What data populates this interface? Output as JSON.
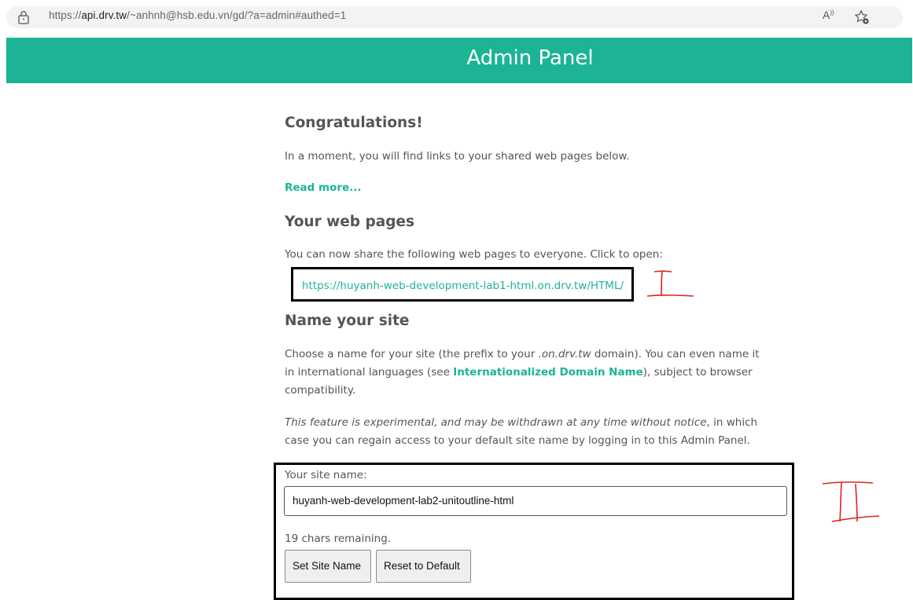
{
  "browser": {
    "url_prefix": "https://",
    "url_host": "api.drv.tw",
    "url_rest": "/~anhnh@hsb.edu.vn/gd/?a=admin#authed=1",
    "read_aloud_label": "A",
    "icons": [
      "site-info-icon",
      "read-aloud-icon",
      "favorites-icon"
    ]
  },
  "header": {
    "title": "Admin Panel",
    "color": "#1cb495"
  },
  "congrats": {
    "heading": "Congratulations!",
    "text": "In a moment, you will find links to your shared web pages below.",
    "read_more": "Read more..."
  },
  "web_pages": {
    "heading": "Your web pages",
    "text": "You can now share the following web pages to everyone. Click to open:",
    "link": "https://huyanh-web-development-lab1-html.on.drv.tw/HTML/"
  },
  "name_site": {
    "heading": "Name your site",
    "p1_a": "Choose a name for your site (the prefix to your ",
    "p1_domain": ".on.drv.tw",
    "p1_b": " domain). You can even name it in international languages (see ",
    "p1_link": "Internationalized Domain Name",
    "p1_c": "), subject to browser compatibility.",
    "p2_italic": "This feature is experimental, and may be withdrawn at any time without notice",
    "p2_rest": ", in which case you can regain access to your default site name by logging in to this Admin Panel.",
    "label": "Your site name:",
    "input_value": "huyanh-web-development-lab2-unitoutline-html",
    "remaining": "19 chars remaining.",
    "set_button": "Set Site Name",
    "reset_button": "Reset to Default"
  },
  "annotations": {
    "mark1": "I",
    "mark2": "II",
    "color": "#e0231c"
  }
}
